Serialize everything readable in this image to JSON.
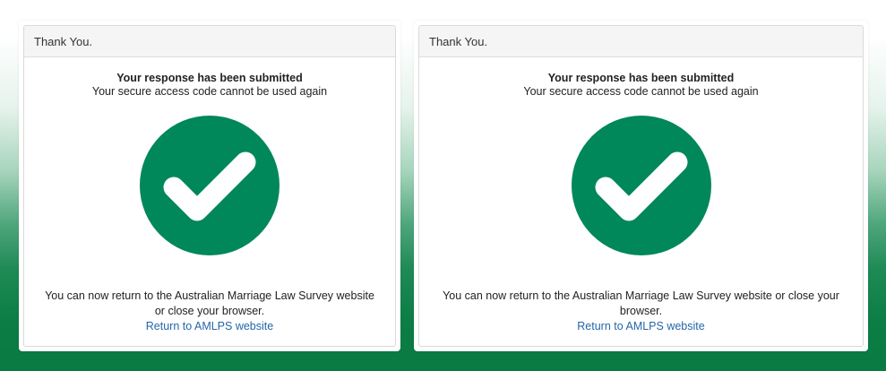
{
  "colors": {
    "check_circle": "#00875a",
    "link": "#2466a8",
    "background_green": "#0a7a43"
  },
  "panels": [
    {
      "heading": "Thank You.",
      "title": "Your response has been submitted",
      "subtitle": "Your secure access code cannot be used again",
      "icon": "checkmark-circle-icon",
      "message": "You can now return to the Australian Marriage Law Survey website or close your browser.",
      "link_label": "Return to AMLPS website"
    },
    {
      "heading": "Thank You.",
      "title": "Your response has been submitted",
      "subtitle": "Your secure access code cannot be used again",
      "icon": "checkmark-circle-icon",
      "message": "You can now return to the Australian Marriage Law Survey website or close your browser.",
      "link_label": "Return to AMLPS website"
    }
  ]
}
